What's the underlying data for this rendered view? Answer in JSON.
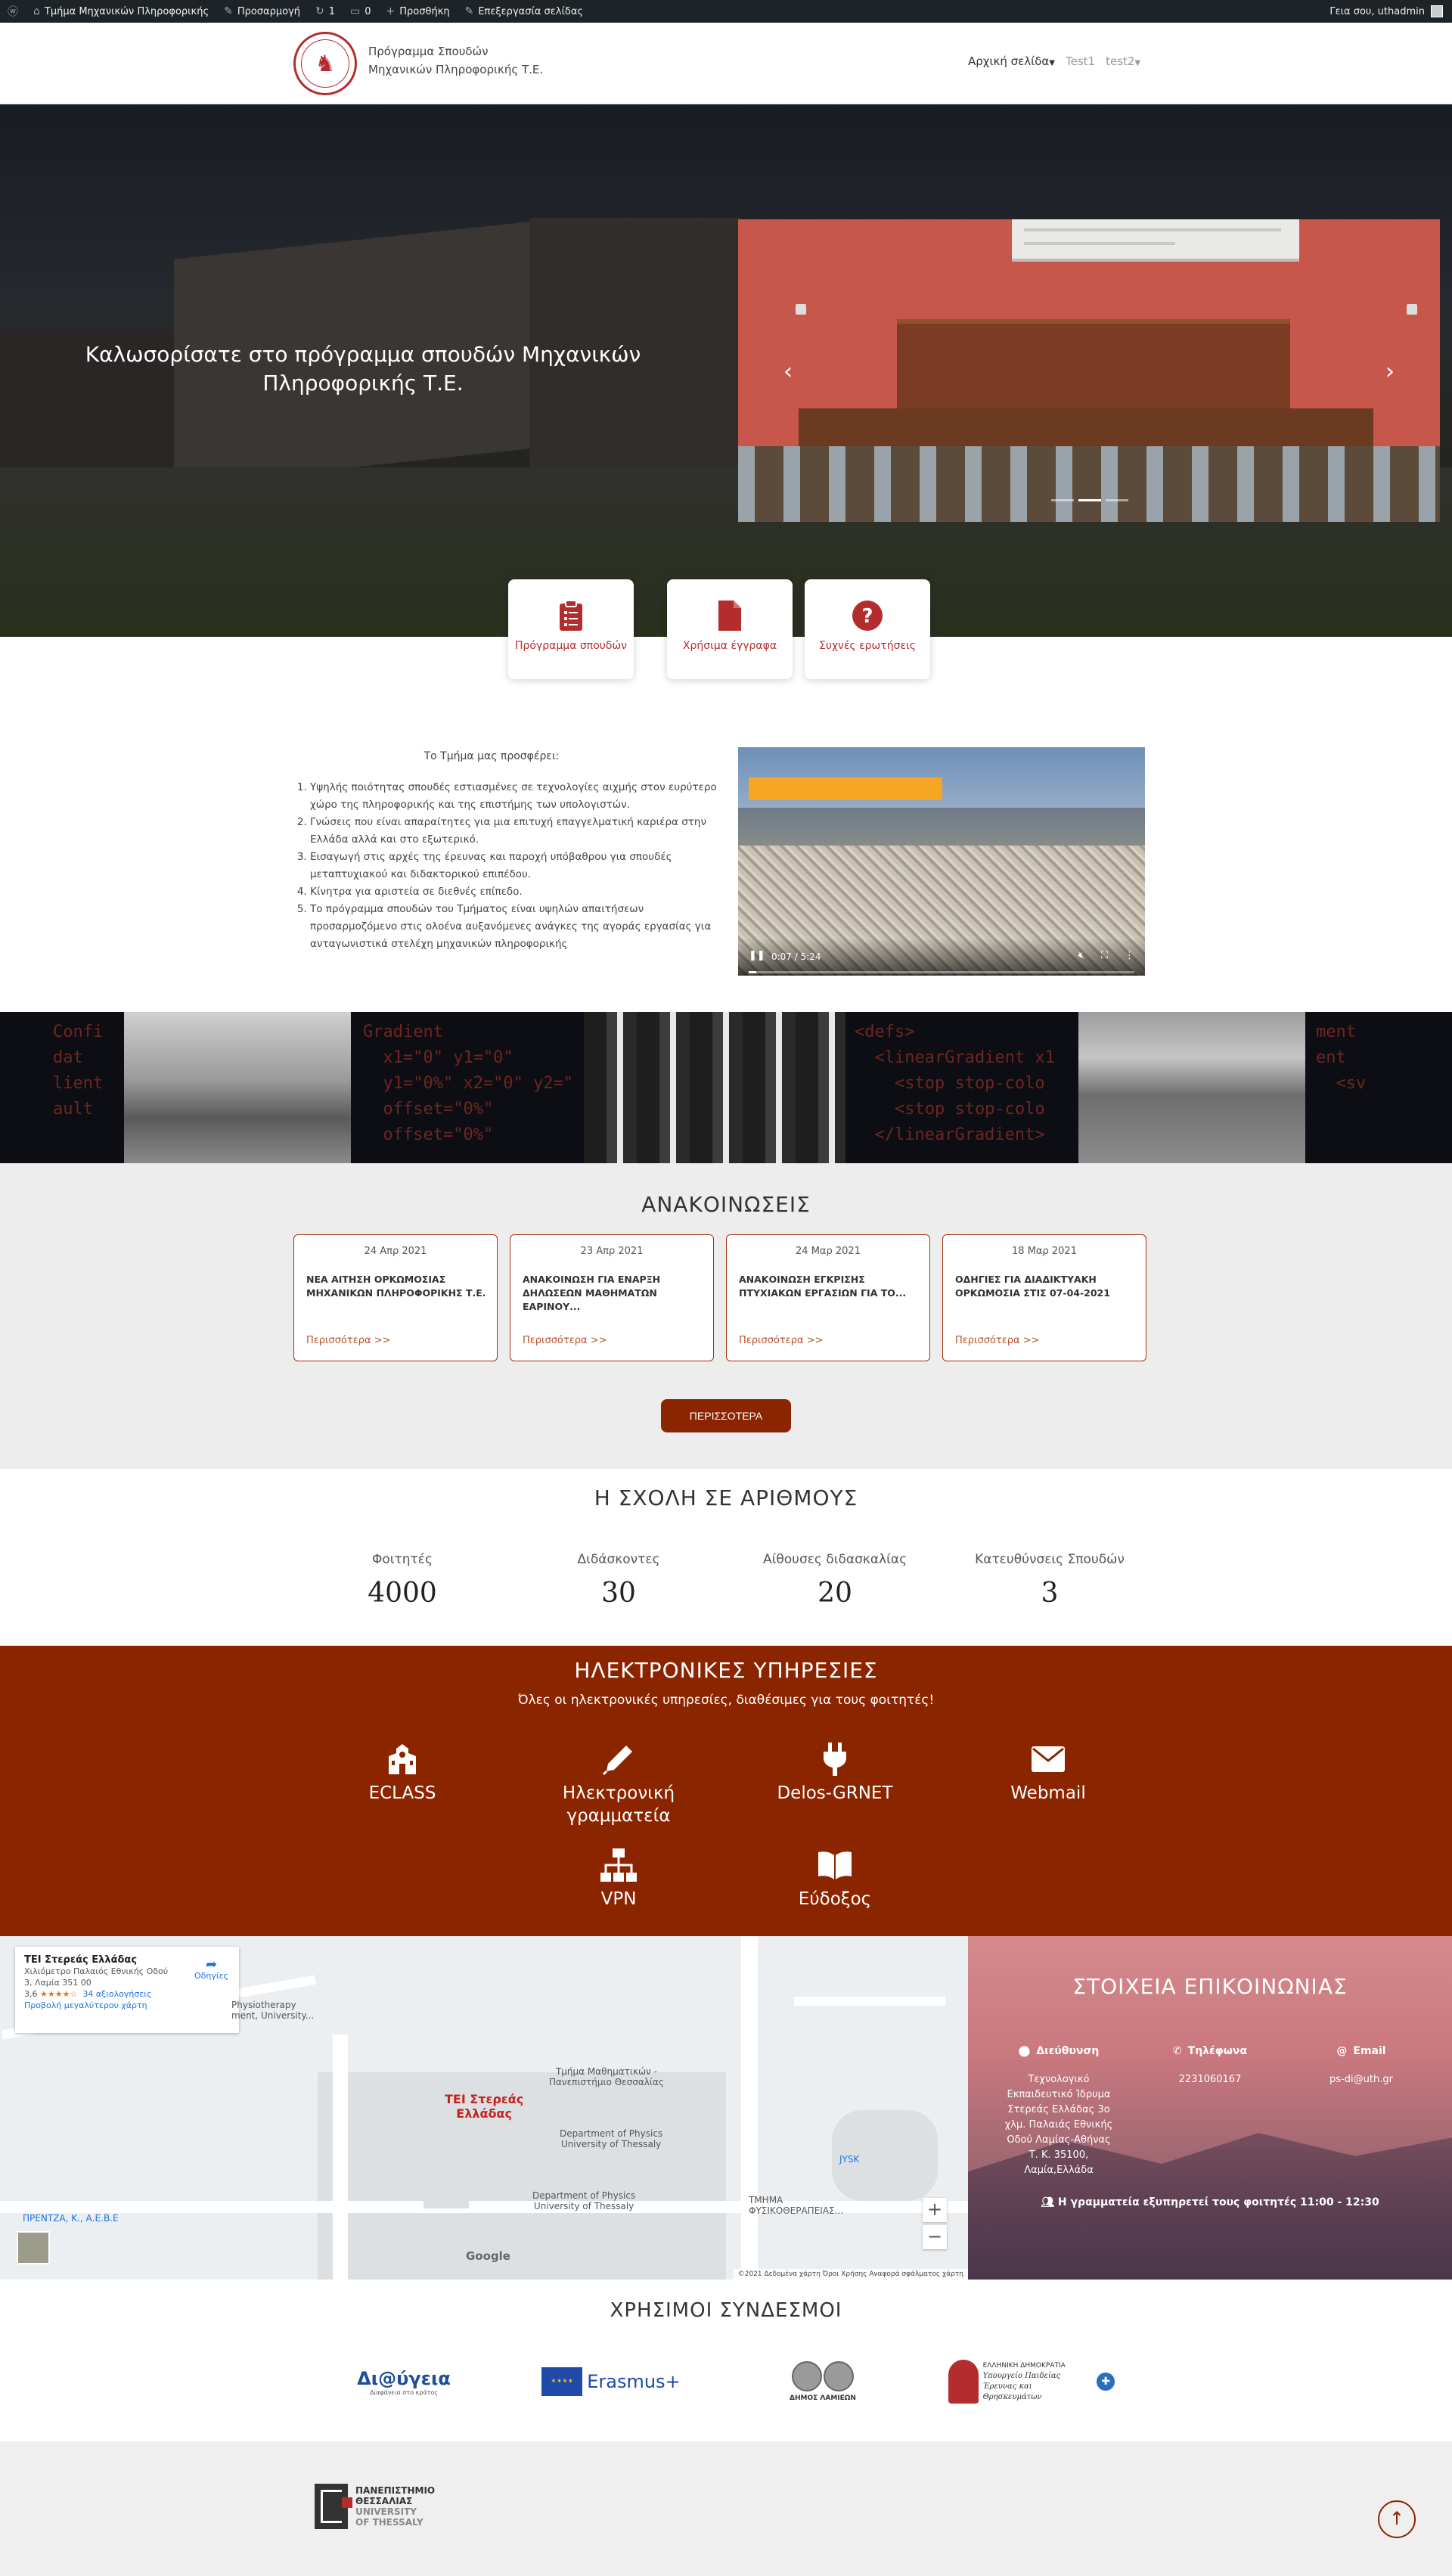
{
  "adminbar": {
    "site": "Τμήμα Μηχανικών Πληροφορικής",
    "customize": "Προσαρμογή",
    "updates": "1",
    "comments": "0",
    "new": "Προσθήκη",
    "edit": "Επεξεργασία σελίδας",
    "greeting": "Γεια σου, uthadmin"
  },
  "header": {
    "brand_line1": "Πρόγραμμα Σπουδών",
    "brand_line2": "Μηχανικών Πληροφορικής Τ.Ε.",
    "nav": [
      "Αρχική σελίδα",
      "Test1",
      "test2"
    ]
  },
  "hero": {
    "title": "Καλωσορίσατε στο πρόγραμμα σπουδών Μηχανικών Πληροφορικής Τ.Ε.",
    "slider_active_index": 1,
    "slider_count": 3
  },
  "quick_links": [
    {
      "label": "Πρόγραμμα σπουδών",
      "icon": "clipboard-list-icon"
    },
    {
      "label": "Χρήσιμα έγγραφα",
      "icon": "file-icon"
    },
    {
      "label": "Συχνές ερωτήσεις",
      "icon": "question-circle-icon"
    }
  ],
  "offer": {
    "title": "Το Τμήμα μας προσφέρει:",
    "items": [
      "Υψηλής ποιότητας σπουδές εστιασμένες σε τεχνολογίες αιχμής στον ευρύτερο χώρο της πληροφορικής και της επιστήμης των υπολογιστών.",
      "Γνώσεις που είναι απαραίτητες για μια επιτυχή επαγγελματική καριέρα στην Ελλάδα αλλά και στο εξωτερικό.",
      "Εισαγωγή στις αρχές της έρευνας και παροχή υπόβαθρου για σπουδές μεταπτυχιακού και διδακτορικού επιπέδου.",
      "Κίνητρα για αριστεία σε διεθνές επίπεδο.",
      "Το πρόγραμμα σπουδών του Τμήματος είναι υψηλών απαιτήσεων προσαρμοζόμενο στις ολοένα αυξανόμενες ανάγκες της αγοράς εργασίας για ανταγωνιστικά στελέχη μηχανικών πληροφορικής"
    ],
    "video_time": "0:07 / 5:24",
    "video_progress": 0.02
  },
  "announcements": {
    "title": "ΑΝΑΚΟΙΝΩΣΕΙΣ",
    "more_link": "Περισσότερα >>",
    "button": "ΠΕΡΙΣΣΟΤΕΡΑ",
    "items": [
      {
        "date": "24 Απρ 2021",
        "title": "ΝΕΑ ΑΙΤΗΣΗ ΟΡΚΩΜΟΣΙΑΣ ΜΗΧΑΝΙΚΩΝ ΠΛΗΡΟΦΟΡΙΚΗΣ Τ.Ε."
      },
      {
        "date": "23 Απρ 2021",
        "title": "ΑΝΑΚΟΙΝΩΣΗ ΓΙΑ ΕΝΑΡΞΗ ΔΗΛΩΣΕΩΝ ΜΑΘΗΜΑΤΩΝ ΕΑΡΙΝΟΥ..."
      },
      {
        "date": "24 Μαρ 2021",
        "title": "ΑΝΑΚΟΙΝΩΣΗ ΕΓΚΡΙΣΗΣ ΠΤΥΧΙΑΚΩΝ ΕΡΓΑΣΙΩΝ ΓΙΑ ΤΟ..."
      },
      {
        "date": "18 Μαρ 2021",
        "title": "ΟΔΗΓΙΕΣ ΓΙΑ ΔΙΑΔΙΚΤΥΑΚΗ ΟΡΚΩΜΟΣΙΑ ΣΤΙΣ 07-04-2021"
      }
    ]
  },
  "stats": {
    "title": "Η ΣΧΟΛΗ ΣΕ ΑΡΙΘΜΟΥΣ",
    "items": [
      {
        "label": "Φοιτητές",
        "value": "4000"
      },
      {
        "label": "Διδάσκοντες",
        "value": "30"
      },
      {
        "label": "Αίθουσες διδασκαλίας",
        "value": "20"
      },
      {
        "label": "Κατευθύνσεις Σπουδών",
        "value": "3"
      }
    ]
  },
  "services": {
    "title": "ΗΛΕΚΤΡΟΝΙΚΕΣ ΥΠΗΡΕΣΙΕΣ",
    "subtitle": "Όλες οι ηλεκτρονικές υπηρεσίες, διαθέσιμες για τους φοιτητές!",
    "items": [
      {
        "label": "ECLASS",
        "icon": "school-icon"
      },
      {
        "label": "Ηλεκτρονική γραμματεία",
        "icon": "pen-icon"
      },
      {
        "label": "Delos-GRNET",
        "icon": "plug-icon"
      },
      {
        "label": "Webmail",
        "icon": "envelope-icon"
      },
      {
        "label": "VPN",
        "icon": "network-icon"
      },
      {
        "label": "Εύδοξος",
        "icon": "book-icon"
      }
    ]
  },
  "map": {
    "place_name": "ΤΕΙ Στερεάς Ελλάδας",
    "address_line1": "Χιλιόμετρο Παλαιός Εθνικής Οδού",
    "address_line2": "3, Λαμία 351 00",
    "rating": "3,6",
    "stars": "★★★★☆",
    "reviews": "34 αξιολογήσεις",
    "larger_map": "Προβολή μεγαλύτερου χάρτη",
    "directions": "Οδηγίες",
    "labels": {
      "physio": "Physiotherapy\nment, University...",
      "math": "Τμήμα Μαθηματικών -\nΠανεπιστήμιο Θεσσαλίας",
      "tei": "ΤΕΙ Στερεάς\nΕλλάδας",
      "physics1": "Department of Physics\nUniversity of Thessaly",
      "physics2": "Department of Physics\nUniversity of Thessaly",
      "jysk": "JYSK",
      "physio2": "ΤΜΗΜΑ\nΦΥΣΙΚΟΘΕΡΑΠΕΙΑΣ...",
      "prentza": "ΠΡΕΝΤΖΑ, Κ., Α.Ε.Β.Ε"
    },
    "attribution": "©2021 Δεδομένα χάρτη   Όροι Χρήσης   Αναφορά σφάλματος χάρτη",
    "google": "Google"
  },
  "contact": {
    "title": "ΣΤΟΙΧΕΙΑ ΕΠΙΚΟΙΝΩΝΙΑΣ",
    "address_label": "Διεύθυνση",
    "address": "Τεχνολογικό Εκπαιδευτικό Ίδρυμα Στερεάς Ελλάδας 3ο χλμ. Παλαιάς Εθνικής Οδού Λαμίας-Αθήνας Τ. Κ. 35100, Λαμία,Ελλάδα",
    "phone_label": "Τηλέφωνα",
    "phone": "2231060167",
    "email_label": "Email",
    "email": "ps-di@uth.gr",
    "note": "Η γραμματεία εξυπηρετεί τους φοιτητές 11:00 - 12:30"
  },
  "links": {
    "title": "ΧΡΗΣΙΜΟΙ ΣΥΝΔΕΣΜΟΙ",
    "diavgeia": "Δι@ύγεια",
    "diavgeia_sub": "Διαφάνεια στο κράτος",
    "erasmus": "Erasmus+",
    "lamia": "ΔΗΜΟΣ ΛΑΜΙΕΩΝ",
    "ministry_1": "ΕΛΛΗΝΙΚΗ ΔΗΜΟΚΡΑΤΙΑ",
    "ministry_2": "Υπουργείο Παιδείας",
    "ministry_3": "Έρευνας και Θρησκευμάτων"
  },
  "footer": {
    "logo_l1": "ΠΑΝΕΠΙΣΤΗΜΙΟ",
    "logo_l2": "ΘΕΣΣΑΛΙΑΣ",
    "logo_l3": "UNIVERSITY",
    "logo_l4": "OF THESSALY"
  },
  "colors": {
    "accent": "#8b2400",
    "link": "#b32d2e"
  }
}
